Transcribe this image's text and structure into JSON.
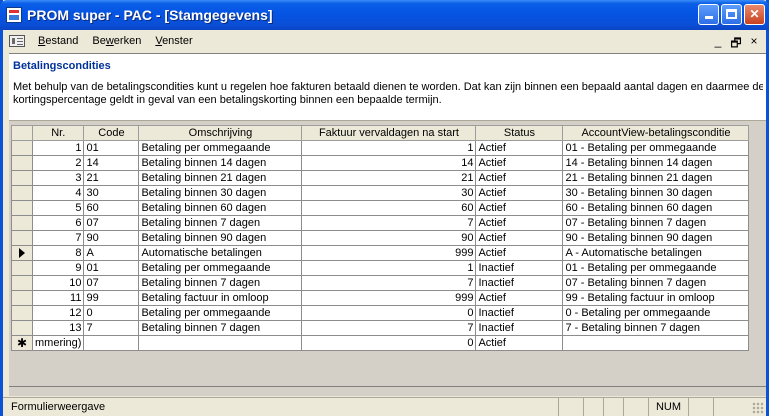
{
  "window": {
    "title": "PROM super - PAC - [Stamgegevens]",
    "close_glyph": "✕"
  },
  "menu": {
    "items": [
      {
        "underline": "B",
        "rest": "estand"
      },
      {
        "pre": "Be",
        "underline": "w",
        "rest": "erken"
      },
      {
        "underline": "V",
        "rest": "enster"
      }
    ],
    "mdi_min": "_",
    "mdi_restore": "🗗",
    "mdi_close": "×"
  },
  "form": {
    "title": "Betalingscondities",
    "description_line1": "Met behulp van de betalingscondities kunt u regelen hoe fakturen betaald dienen te worden. Dat kan zijn binnen een bepaald aantal dagen en daarmee de vo",
    "description_line2": "kortingspercentage geldt in geval van een betalingskorting binnen een bepaalde termijn."
  },
  "grid": {
    "columns": [
      "Nr.",
      "Code",
      "Omschrijving",
      "Faktuur vervaldagen na start",
      "Status",
      "AccountView-betalingsconditie"
    ],
    "rows": [
      {
        "nr": "1",
        "code": "01",
        "omschrijving": "Betaling per ommegaande",
        "dagen": "1",
        "status": "Actief",
        "av": "01 - Betaling per ommegaande"
      },
      {
        "nr": "2",
        "code": "14",
        "omschrijving": "Betaling binnen 14 dagen",
        "dagen": "14",
        "status": "Actief",
        "av": "14 - Betaling binnen 14 dagen"
      },
      {
        "nr": "3",
        "code": "21",
        "omschrijving": "Betaling binnen 21 dagen",
        "dagen": "21",
        "status": "Actief",
        "av": "21 - Betaling binnen 21 dagen"
      },
      {
        "nr": "4",
        "code": "30",
        "omschrijving": "Betaling binnen 30 dagen",
        "dagen": "30",
        "status": "Actief",
        "av": "30 - Betaling binnen 30 dagen"
      },
      {
        "nr": "5",
        "code": "60",
        "omschrijving": "Betaling binnen 60 dagen",
        "dagen": "60",
        "status": "Actief",
        "av": "60 - Betaling binnen 60 dagen"
      },
      {
        "nr": "6",
        "code": "07",
        "omschrijving": "Betaling binnen 7 dagen",
        "dagen": "7",
        "status": "Actief",
        "av": "07 - Betaling binnen 7 dagen"
      },
      {
        "nr": "7",
        "code": "90",
        "omschrijving": "Betaling binnen 90 dagen",
        "dagen": "90",
        "status": "Actief",
        "av": "90 - Betaling binnen 90 dagen"
      },
      {
        "nr": "8",
        "code": "A",
        "omschrijving": "Automatische betalingen",
        "dagen": "999",
        "status": "Actief",
        "av": "A - Automatische betalingen",
        "current": true
      },
      {
        "nr": "9",
        "code": "01",
        "omschrijving": "Betaling per ommegaande",
        "dagen": "1",
        "status": "Inactief",
        "av": "01 - Betaling per ommegaande"
      },
      {
        "nr": "10",
        "code": "07",
        "omschrijving": "Betaling binnen 7 dagen",
        "dagen": "7",
        "status": "Inactief",
        "av": "07 - Betaling binnen 7 dagen"
      },
      {
        "nr": "11",
        "code": "99",
        "omschrijving": "Betaling factuur in omloop",
        "dagen": "999",
        "status": "Actief",
        "av": "99 - Betaling factuur in omloop"
      },
      {
        "nr": "12",
        "code": "0",
        "omschrijving": "Betaling per ommegaande",
        "dagen": "0",
        "status": "Inactief",
        "av": "0 - Betaling per ommegaande"
      },
      {
        "nr": "13",
        "code": "7",
        "omschrijving": "Betaling binnen 7 dagen",
        "dagen": "7",
        "status": "Inactief",
        "av": "7 - Betaling binnen 7 dagen"
      }
    ],
    "new_row": {
      "nr": "mmering)",
      "dagen": "0",
      "status": "Actief",
      "marker": "✱"
    },
    "current_marker": "arrow"
  },
  "statusbar": {
    "mode": "Formulierweergave",
    "num": "NUM"
  }
}
